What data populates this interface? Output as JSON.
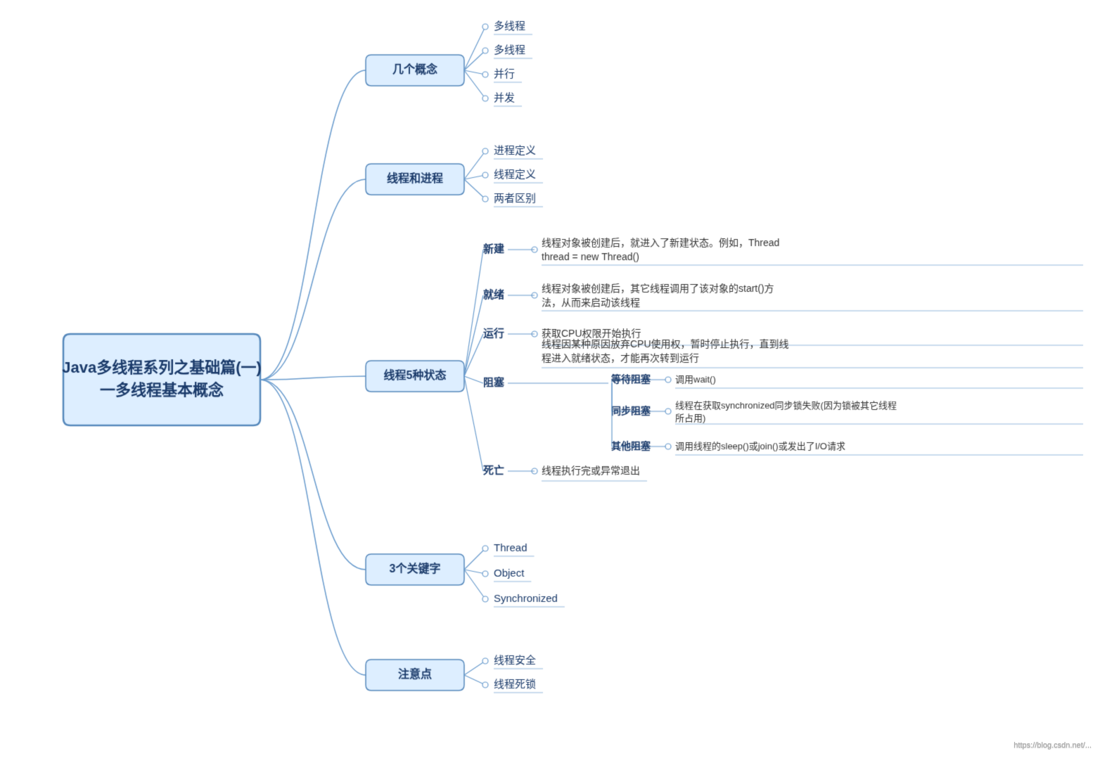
{
  "title": "Java多线程系列之基础篇(一)一多线程基本概念",
  "watermark": "https://blog.csdn.net/...",
  "colors": {
    "main_box_bg": "#ddeeff",
    "main_box_border": "#5588bb",
    "main_box_text": "#1a3a6a",
    "node_bg": "#ddeeff",
    "node_border": "#5588bb",
    "node_text": "#1a3a6a",
    "leaf_text": "#1a3a6a",
    "line": "#6699cc",
    "detail_text": "#333"
  },
  "nodes": {
    "root": "Java多线程系列之基础篇(一)\n一多线程基本概念",
    "concepts": {
      "label": "几个概念",
      "items": [
        "多线程",
        "多线程",
        "并行",
        "并发"
      ]
    },
    "thread_process": {
      "label": "线程和进程",
      "items": [
        "进程定义",
        "线程定义",
        "两者区别"
      ]
    },
    "five_states": {
      "label": "线程5种状态",
      "states": [
        {
          "name": "新建",
          "detail": "线程对象被创建后，就进入了新建状态。例如，Thread\nthread = new Thread()"
        },
        {
          "name": "就绪",
          "detail": "线程对象被创建后，其它线程调用了该对象的start()方\n法，从而来启动该线程"
        },
        {
          "name": "运行",
          "detail": "获取CPU权限开始执行"
        },
        {
          "name": "阻塞",
          "detail": "线程因某种原因放弃CPU使用权，暂时停止执行，直到线\n程进入就绪状态，才能再次转到运行",
          "sub": [
            {
              "name": "等待阻塞",
              "detail": "调用wait()"
            },
            {
              "name": "同步阻塞",
              "detail": "线程在获取synchronized同步锁失败(因为锁被其它线程\n所占用)"
            },
            {
              "name": "其他阻塞",
              "detail": "调用线程的sleep()或join()或发出了I/O请求"
            }
          ]
        },
        {
          "name": "死亡",
          "detail": "线程执行完或异常退出"
        }
      ]
    },
    "keywords": {
      "label": "3个关键字",
      "items": [
        "Thread",
        "Object",
        "Synchronized"
      ]
    },
    "notes": {
      "label": "注意点",
      "items": [
        "线程安全",
        "线程死锁"
      ]
    }
  }
}
